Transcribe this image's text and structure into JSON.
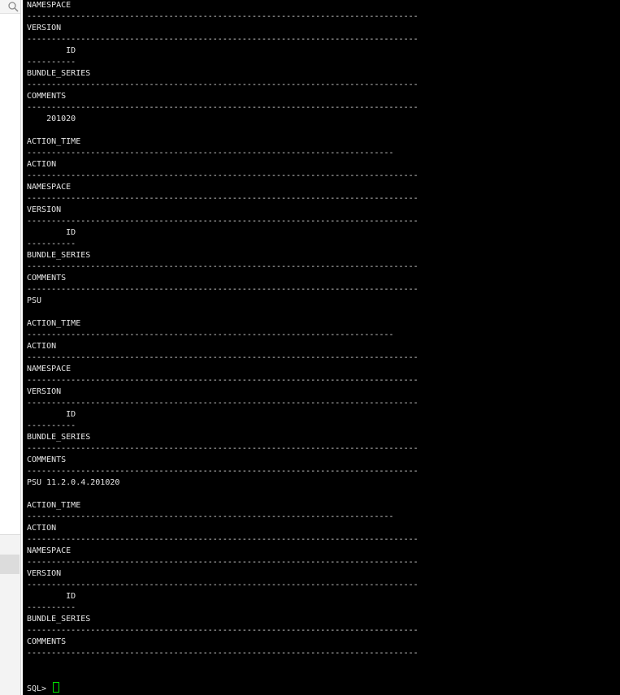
{
  "terminal": {
    "lines": [
      "NAMESPACE",
      "--------------------------------------------------------------------------------",
      "VERSION",
      "--------------------------------------------------------------------------------",
      "        ID",
      "----------",
      "BUNDLE_SERIES",
      "--------------------------------------------------------------------------------",
      "COMMENTS",
      "--------------------------------------------------------------------------------",
      "    201020",
      "",
      "ACTION_TIME",
      "---------------------------------------------------------------------------",
      "ACTION",
      "--------------------------------------------------------------------------------",
      "NAMESPACE",
      "--------------------------------------------------------------------------------",
      "VERSION",
      "--------------------------------------------------------------------------------",
      "        ID",
      "----------",
      "BUNDLE_SERIES",
      "--------------------------------------------------------------------------------",
      "COMMENTS",
      "--------------------------------------------------------------------------------",
      "PSU",
      "",
      "ACTION_TIME",
      "---------------------------------------------------------------------------",
      "ACTION",
      "--------------------------------------------------------------------------------",
      "NAMESPACE",
      "--------------------------------------------------------------------------------",
      "VERSION",
      "--------------------------------------------------------------------------------",
      "        ID",
      "----------",
      "BUNDLE_SERIES",
      "--------------------------------------------------------------------------------",
      "COMMENTS",
      "--------------------------------------------------------------------------------",
      "PSU 11.2.0.4.201020",
      "",
      "ACTION_TIME",
      "---------------------------------------------------------------------------",
      "ACTION",
      "--------------------------------------------------------------------------------",
      "NAMESPACE",
      "--------------------------------------------------------------------------------",
      "VERSION",
      "--------------------------------------------------------------------------------",
      "        ID",
      "----------",
      "BUNDLE_SERIES",
      "--------------------------------------------------------------------------------",
      "COMMENTS",
      "--------------------------------------------------------------------------------"
    ],
    "prompt": "SQL> "
  },
  "icons": {
    "search": "search-icon",
    "cursor": "terminal-cursor"
  },
  "colors": {
    "terminal_background": "#000000",
    "terminal_text": "#e6e6e6",
    "cursor": "#00e000"
  }
}
